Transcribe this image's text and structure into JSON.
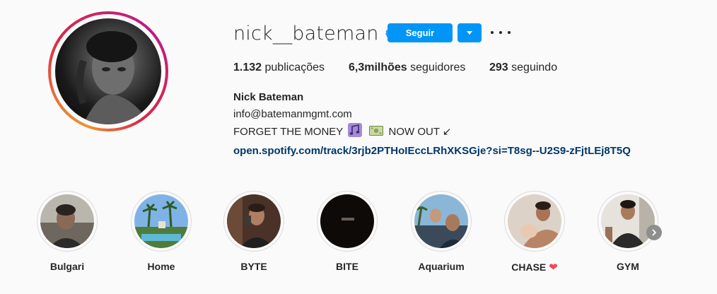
{
  "profile": {
    "username": "nick__bateman",
    "follow_label": "Seguir",
    "stats": {
      "posts_count": "1.132",
      "posts_label": "publicações",
      "followers_count": "6,3milhões",
      "followers_label": "seguidores",
      "following_count": "293",
      "following_label": "seguindo"
    },
    "bio": {
      "name": "Nick Bateman",
      "email": "info@batemanmgmt.com",
      "line_before": "FORGET THE MONEY",
      "line_after": "NOW OUT ↙",
      "link": "open.spotify.com/track/3rjb2PTHoIEccLRhXKSGje?si=T8sg--U2S9-zFjtLEj8T5Q"
    }
  },
  "highlights": [
    {
      "label": "Bulgari"
    },
    {
      "label": "Home"
    },
    {
      "label": "BYTE"
    },
    {
      "label": "BITE"
    },
    {
      "label": "Aquarium"
    },
    {
      "label": "CHASE",
      "suffix": "❤"
    },
    {
      "label": "GYM"
    }
  ],
  "colors": {
    "accent": "#0095f6",
    "link": "#00376b",
    "verified": "#3897f0",
    "heart": "#ed4956"
  },
  "icons": {
    "verified": "verified-badge-icon",
    "dropdown": "chevron-down-icon",
    "more": "more-options-icon",
    "next": "chevron-right-icon",
    "note": "musical-notes-emoji",
    "money": "dollar-banknote-emoji"
  }
}
